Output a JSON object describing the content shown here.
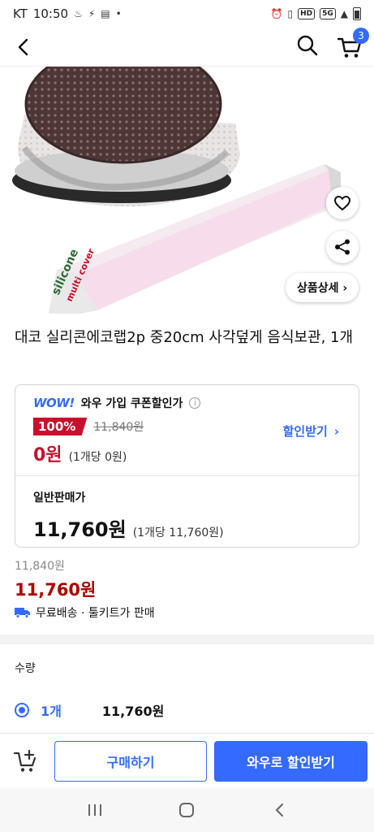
{
  "status_bar": {
    "carrier": "KT",
    "time": "10:50",
    "hd_badge": "HD",
    "network_badge": "5G"
  },
  "header": {
    "cart_count": "3"
  },
  "product": {
    "title": "대코 실리콘에코랩2p 중20cm 사각덮게 음식보관, 1개",
    "detail_button": "상품상세 ›"
  },
  "coupon": {
    "wow_logo": "WOW!",
    "title": "와우 가입 쿠폰할인가",
    "info_icon": "i",
    "discount_rate": "100%",
    "strike_price": "11,840원",
    "zero_price": "0원",
    "zero_unit": "(1개당 0원)",
    "link_label": "할인받기",
    "link_chevron": "›",
    "regular_label": "일반판매가",
    "regular_price": "11,760원",
    "regular_unit": "(1개당 11,760원)"
  },
  "price_summary": {
    "original": "11,840원",
    "sale": "11,760원",
    "shipping": "무료배송 · 툴키트가 판매"
  },
  "quantity": {
    "label": "수량",
    "option": "1개",
    "price": "11,760원"
  },
  "actions": {
    "buy": "구매하기",
    "wow_discount": "와우로 할인받기"
  },
  "colors": {
    "accent": "#346aff",
    "sale_red": "#ae0000",
    "badge_red": "#c8102e"
  },
  "icons": [
    "back-icon",
    "search-icon",
    "cart-icon",
    "heart-icon",
    "share-icon",
    "truck-icon",
    "cart-add-icon",
    "recents-icon",
    "home-icon",
    "nav-back-icon"
  ]
}
